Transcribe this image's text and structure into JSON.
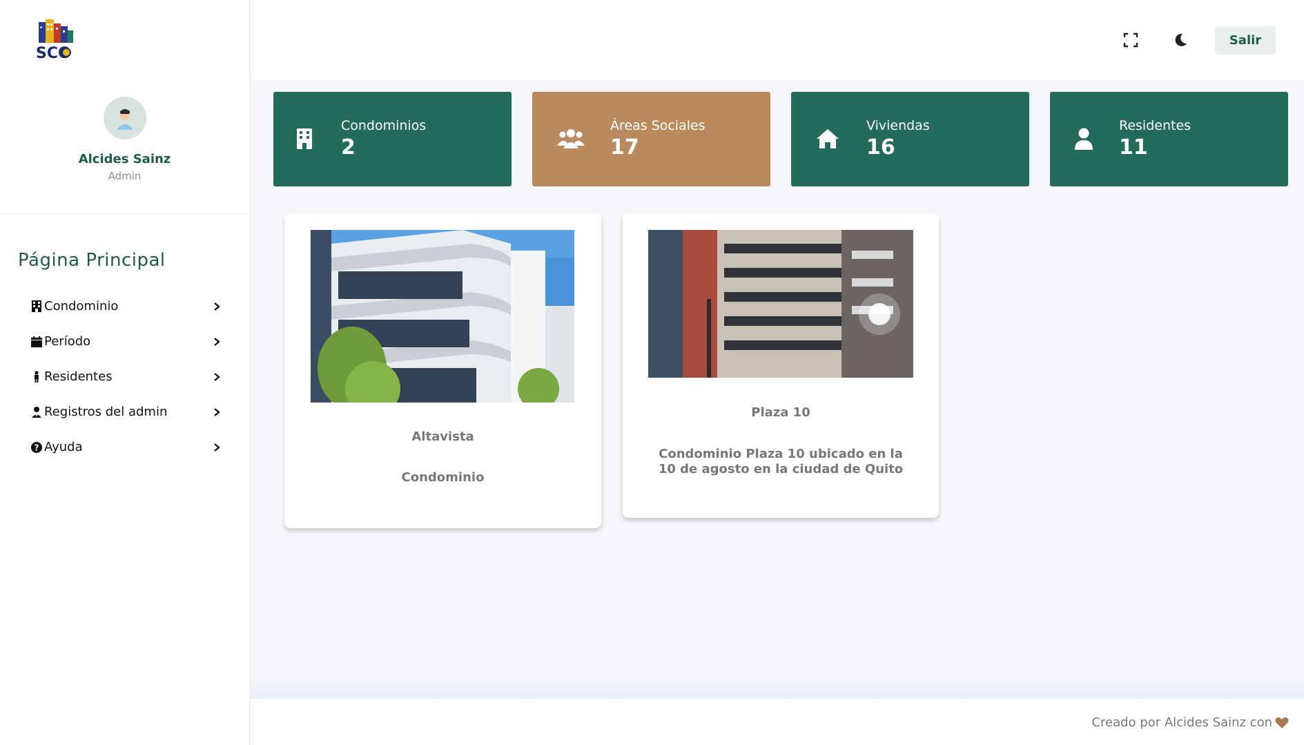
{
  "profile": {
    "name": "Alcides Sainz",
    "role": "Admin",
    "logo_text": "SCC"
  },
  "menu": {
    "title": "Página Principal",
    "items": [
      {
        "label": "Condominio",
        "icon": "building-icon"
      },
      {
        "label": "Período",
        "icon": "calendar-icon"
      },
      {
        "label": "Residentes",
        "icon": "person-icon"
      },
      {
        "label": "Registros del admin",
        "icon": "user-tie-icon"
      },
      {
        "label": "Ayuda",
        "icon": "question-circle-icon"
      }
    ]
  },
  "topbar": {
    "fullscreen_icon": "fullscreen-icon",
    "theme_icon": "moon-icon",
    "logout_label": "Salir"
  },
  "stats": [
    {
      "label": "Condominios",
      "value": "2",
      "icon": "building-icon",
      "color": "#246b5c"
    },
    {
      "label": "Áreas Sociales",
      "value": "17",
      "icon": "users-icon",
      "color": "#b98a5e"
    },
    {
      "label": "Viviendas",
      "value": "16",
      "icon": "home-icon",
      "color": "#246b5c"
    },
    {
      "label": "Residentes",
      "value": "11",
      "icon": "user-icon",
      "color": "#246b5c"
    }
  ],
  "condos": [
    {
      "name": "Altavista",
      "description": "Condominio"
    },
    {
      "name": "Plaza 10",
      "description": "Condominio Plaza 10 ubicado en la 10 de agosto en la ciudad de Quito"
    }
  ],
  "footer": {
    "text": "Creado por Alcides Sainz con",
    "heart_color": "#a67a52"
  }
}
